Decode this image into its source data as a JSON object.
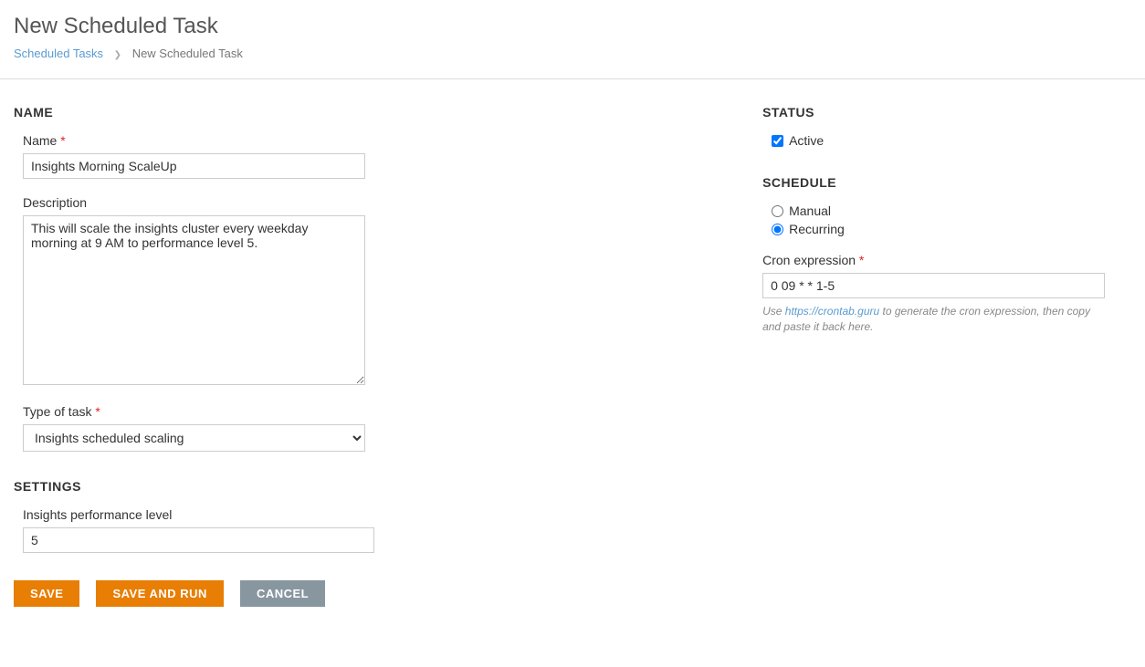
{
  "header": {
    "title": "New Scheduled Task",
    "breadcrumb": {
      "link": "Scheduled Tasks",
      "current": "New Scheduled Task"
    }
  },
  "sections": {
    "name": {
      "heading": "NAME",
      "name_label": "Name",
      "name_value": "Insights Morning ScaleUp",
      "description_label": "Description",
      "description_value": "This will scale the insights cluster every weekday morning at 9 AM to performance level 5.",
      "type_label": "Type of task",
      "type_value": "Insights scheduled scaling"
    },
    "settings": {
      "heading": "SETTINGS",
      "perf_label": "Insights performance level",
      "perf_value": "5"
    },
    "status": {
      "heading": "STATUS",
      "active_label": "Active",
      "active_checked": true
    },
    "schedule": {
      "heading": "SCHEDULE",
      "manual_label": "Manual",
      "recurring_label": "Recurring",
      "selected": "recurring",
      "cron_label": "Cron expression",
      "cron_value": "0 09 * * 1-5",
      "help_prefix": "Use ",
      "help_link_text": "https://crontab.guru",
      "help_suffix": " to generate the cron expression, then copy and paste it back here."
    }
  },
  "buttons": {
    "save": "Save",
    "save_run": "Save and Run",
    "cancel": "Cancel"
  }
}
